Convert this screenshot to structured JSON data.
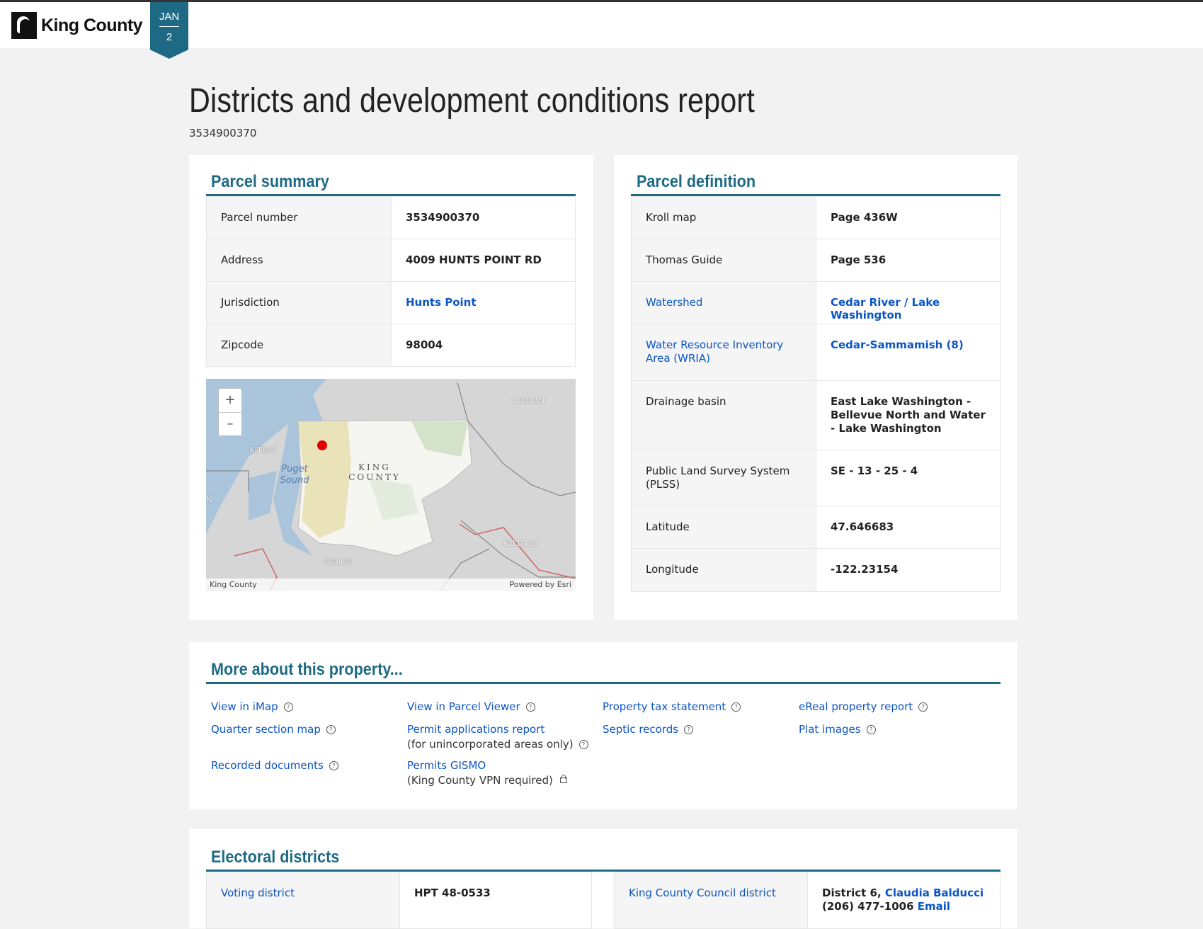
{
  "header": {
    "logo_text": "King County",
    "date_month": "JAN",
    "date_day": "2"
  },
  "page": {
    "title": "Districts and development conditions report",
    "parcel_id": "3534900370"
  },
  "parcel_summary": {
    "title": "Parcel summary",
    "rows": [
      {
        "label": "Parcel number",
        "value": "3534900370"
      },
      {
        "label": "Address",
        "value": "4009 HUNTS POINT RD"
      },
      {
        "label": "Jurisdiction",
        "value": "Hunts Point"
      },
      {
        "label": "Zipcode",
        "value": "98004"
      }
    ]
  },
  "map": {
    "zoom_in": "+",
    "zoom_out": "–",
    "labels": {
      "chelan": "CHELAN",
      "kitsap": "KITSAP",
      "puget_sound": "Puget Sound",
      "king_county": "KING COUNTY",
      "kittitas": "KITTITAS",
      "pierce": "PIERCE",
      "mason": "N"
    },
    "attribution_left": "King County",
    "attribution_right": "Powered by Esri"
  },
  "parcel_definition": {
    "title": "Parcel definition",
    "rows": [
      {
        "label": "Kroll map",
        "value": "Page 436W"
      },
      {
        "label": "Thomas Guide",
        "value": "Page 536"
      },
      {
        "label": "Watershed",
        "value": "Cedar River / Lake Washington"
      },
      {
        "label": "Water Resource Inventory Area (WRIA)",
        "value": "Cedar-Sammamish (8)"
      },
      {
        "label": "Drainage basin",
        "value": "East Lake Washington - Bellevue North and Water - Lake Washington"
      },
      {
        "label": "Public Land Survey System (PLSS)",
        "value": "SE - 13 - 25 - 4"
      },
      {
        "label": "Latitude",
        "value": "47.646683"
      },
      {
        "label": "Longitude",
        "value": "-122.23154"
      }
    ]
  },
  "more": {
    "title": "More about this property...",
    "view_imap": "View in iMap",
    "quarter_section": "Quarter section map",
    "recorded_docs": "Recorded documents",
    "parcel_viewer": "View in Parcel Viewer",
    "permit_apps": "Permit applications report",
    "permit_apps_note": "(for unincorporated areas only)",
    "permits_gismo": "Permits GISMO",
    "permits_gismo_note": "(King County VPN required)",
    "tax_statement": "Property tax statement",
    "septic": "Septic records",
    "ereal": "eReal property report",
    "plat": "Plat images"
  },
  "electoral": {
    "title": "Electoral districts",
    "voting_label": "Voting district",
    "voting_value": "HPT 48-0533",
    "council_label": "King County Council district",
    "council_prefix": "District 6,",
    "council_member": "Claudia Balducci",
    "council_phone": "(206) 477-1006",
    "council_email": "Email"
  },
  "colors": {
    "accent": "#1e6a84",
    "link": "#0b55c5",
    "background": "#f2f2f2"
  }
}
